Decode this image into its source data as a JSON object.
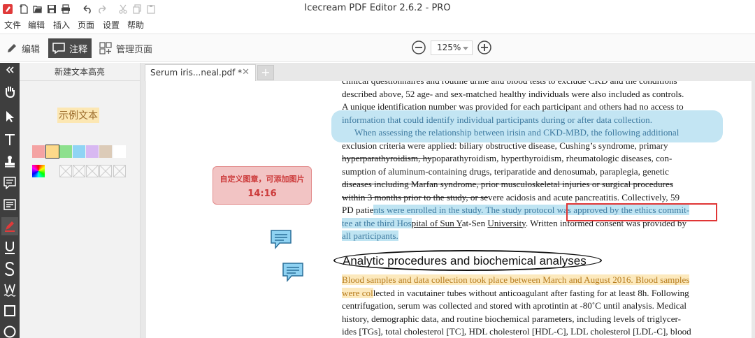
{
  "app": {
    "title": "Icecream PDF Editor 2.6.2 - PRO"
  },
  "menu": {
    "items": [
      "文件",
      "编辑",
      "插入",
      "页面",
      "设置",
      "帮助"
    ]
  },
  "toolbar": {
    "modes": [
      "编辑",
      "注释",
      "管理页面"
    ],
    "active_mode": "注释",
    "zoom": "125%"
  },
  "panel": {
    "title": "新建文本高亮",
    "sample_text": "示例文本",
    "colors": [
      "#f4a3a3",
      "#fcd98a",
      "#8de08d",
      "#8fd4f4",
      "#d8b8f2",
      "#dccbb8",
      "#ffffff"
    ]
  },
  "document": {
    "tab_label": "Serum iris...neal.pdf *",
    "stamp": {
      "line1": "自定义图章，可添加图片",
      "line2": "14:16"
    },
    "heading": "Analytic procedures and biochemical analyses",
    "p1": {
      "l1": "clinical questionnaires and routine urine and blood tests to exclude CKD and the conditions",
      "l2": "described above, 52 age- and sex-matched healthy individuals were also included as controls.",
      "l3": "A unique identification number was provided for each participant and others had no access to",
      "l4": "information that could identify individual participants during or after data collection.",
      "l5": "When assessing the relationship between irisin and CKD-MBD, the following additional",
      "l6": "exclusion criteria were applied: biliary obstructive disease, Cushing’s syndrome, primary",
      "l7a": "hyperparathyroidism, hy",
      "l7b": "poparathyroidism, hyperthyroidism, rheumatologic diseases, con-",
      "l8": "sumption of aluminum-containing drugs, teriparatide and denosumab, paraplegia, genetic",
      "l9": "diseases including Marfan syndrome, prior musculoskeletal injuries or surgical procedures",
      "l10a": "within 3 months prior to the study, or se",
      "l10b": "vere acidosis and acute pancreatitis. Collectively, 59",
      "l11a": "PD patie",
      "l11b": "nts were enrolled in the study. The study protoco",
      "l11c": "l was approved by the ethics commit-",
      "l12a": "tee at the third Hos",
      "l12b": "pital of Sun ",
      "l12c": "Y",
      "l12d": "at-Sen ",
      "l12e": "University",
      "l12f": ". Written informed consent was provided by",
      "l13": "all participants."
    },
    "p2": {
      "l1": "Blood samples and data collection took place between March and August 2016. Blood samples",
      "l2a": "were col",
      "l2b": "lected in vacutainer tubes without anticoagulant after fasting for at least 8h. Following",
      "l3": "centrifugation, serum was collected and stored with aprotintin at -80˚C until analysis. Medical",
      "l4": "history, demographic data, and routine biochemical parameters, including levels of triglycer-",
      "l5": "ides [TGs], total cholesterol [TC], HDL cholesterol [HDL-C], LDL cholesterol [LDL-C], blood"
    }
  }
}
